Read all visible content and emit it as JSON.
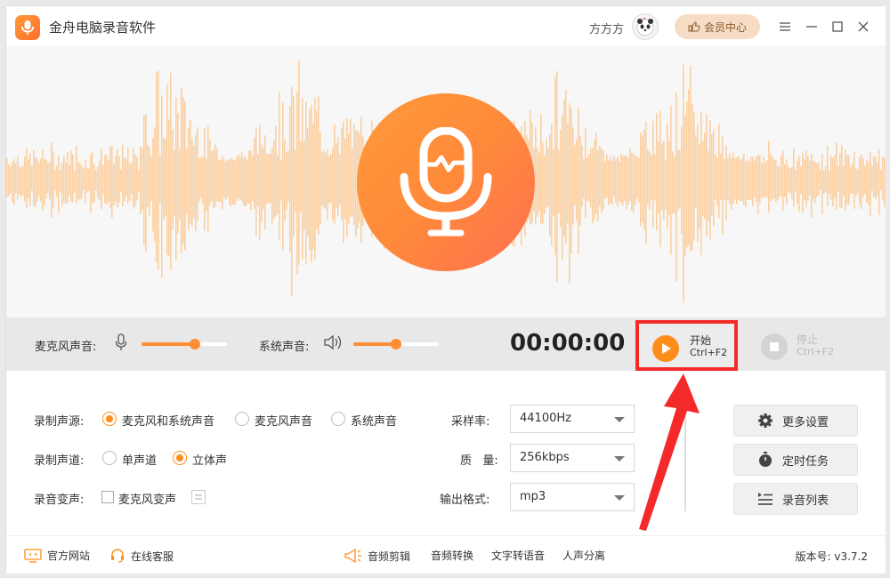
{
  "app": {
    "title": "金舟电脑录音软件"
  },
  "header": {
    "user_name": "方方方",
    "vip_label": "会员中心"
  },
  "controls": {
    "mic_label": "麦克风声音:",
    "mic_level": 0.62,
    "sys_label": "系统声音:",
    "sys_level": 0.5,
    "timer": "00:00:00",
    "start_label": "开始",
    "start_shortcut": "Ctrl+F2",
    "stop_label": "停止",
    "stop_shortcut": "Ctrl+F2"
  },
  "settings": {
    "source_label": "录制声源:",
    "source_options": [
      "麦克风和系统声音",
      "麦克风声音",
      "系统声音"
    ],
    "source_selected": 0,
    "channel_label": "录制声道:",
    "channel_options": [
      "单声道",
      "立体声"
    ],
    "channel_selected": 1,
    "voice_label": "录音变声:",
    "voice_option": "麦克风变声",
    "sample_label": "采样率:",
    "sample_value": "44100Hz",
    "quality_label": "质   量:",
    "quality_value": "256kbps",
    "format_label": "输出格式:",
    "format_value": "mp3"
  },
  "side": {
    "more_settings": "更多设置",
    "scheduled_task": "定时任务",
    "record_list": "录音列表"
  },
  "footer": {
    "website": "官方网站",
    "support": "在线客服",
    "audio_cut": "音频剪辑",
    "audio_convert": "音频转换",
    "tts": "文字转语音",
    "vocal_separate": "人声分离",
    "version": "版本号: v3.7.2"
  },
  "colors": {
    "accent": "#ff8d1a",
    "highlight": "#f42a2a",
    "wave": "#fbd0a3"
  }
}
